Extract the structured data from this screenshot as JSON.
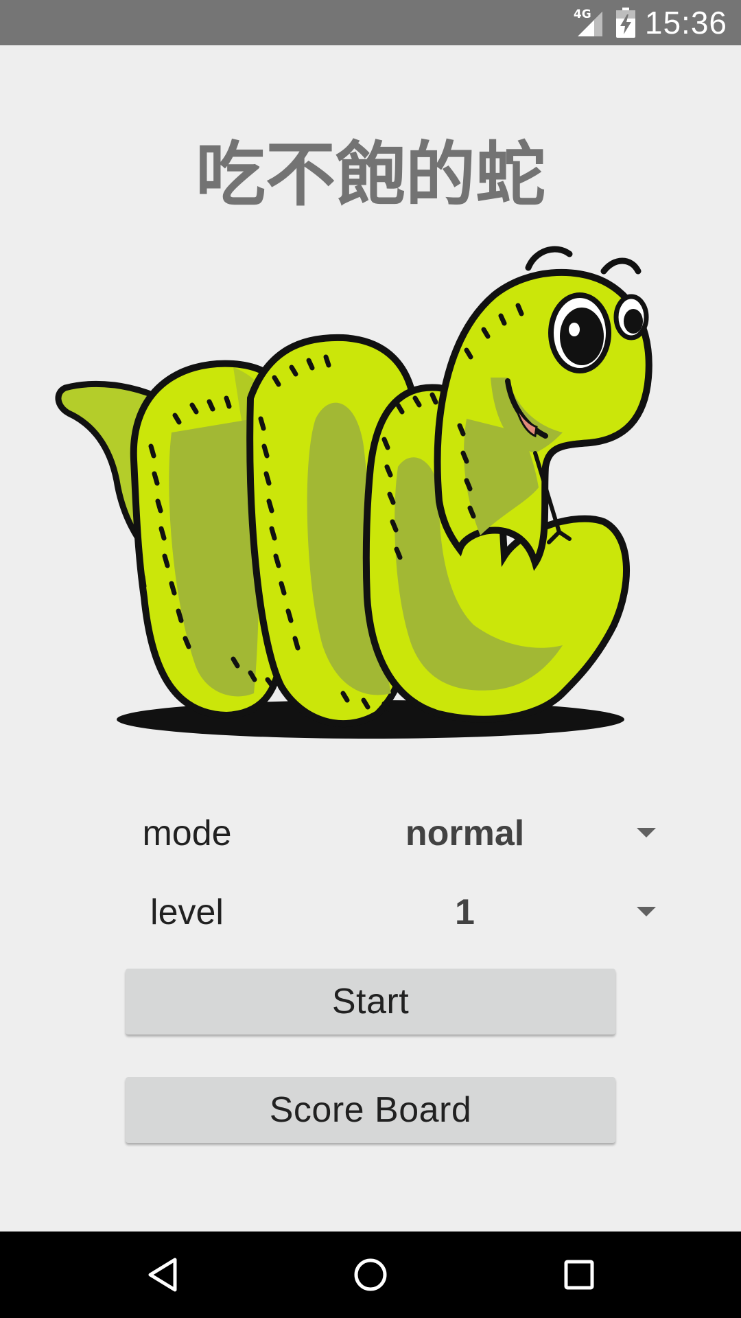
{
  "status_bar": {
    "network": "4G",
    "time": "15:36",
    "icons": [
      "signal-icon",
      "battery-charging-icon"
    ]
  },
  "app": {
    "title": "吃不飽的蛇",
    "illustration": "cartoon-green-snake"
  },
  "settings": {
    "mode": {
      "label": "mode",
      "value": "normal"
    },
    "level": {
      "label": "level",
      "value": "1"
    }
  },
  "buttons": {
    "start": "Start",
    "score_board": "Score Board"
  },
  "nav_bar": {
    "icons": [
      "back-icon",
      "home-icon",
      "recents-icon"
    ]
  },
  "colors": {
    "status_bar": "#757575",
    "background": "#eeeeee",
    "title": "#737373",
    "button": "#d6d7d7",
    "snake_light": "#cbe60a",
    "snake_dark": "#a2b834"
  }
}
